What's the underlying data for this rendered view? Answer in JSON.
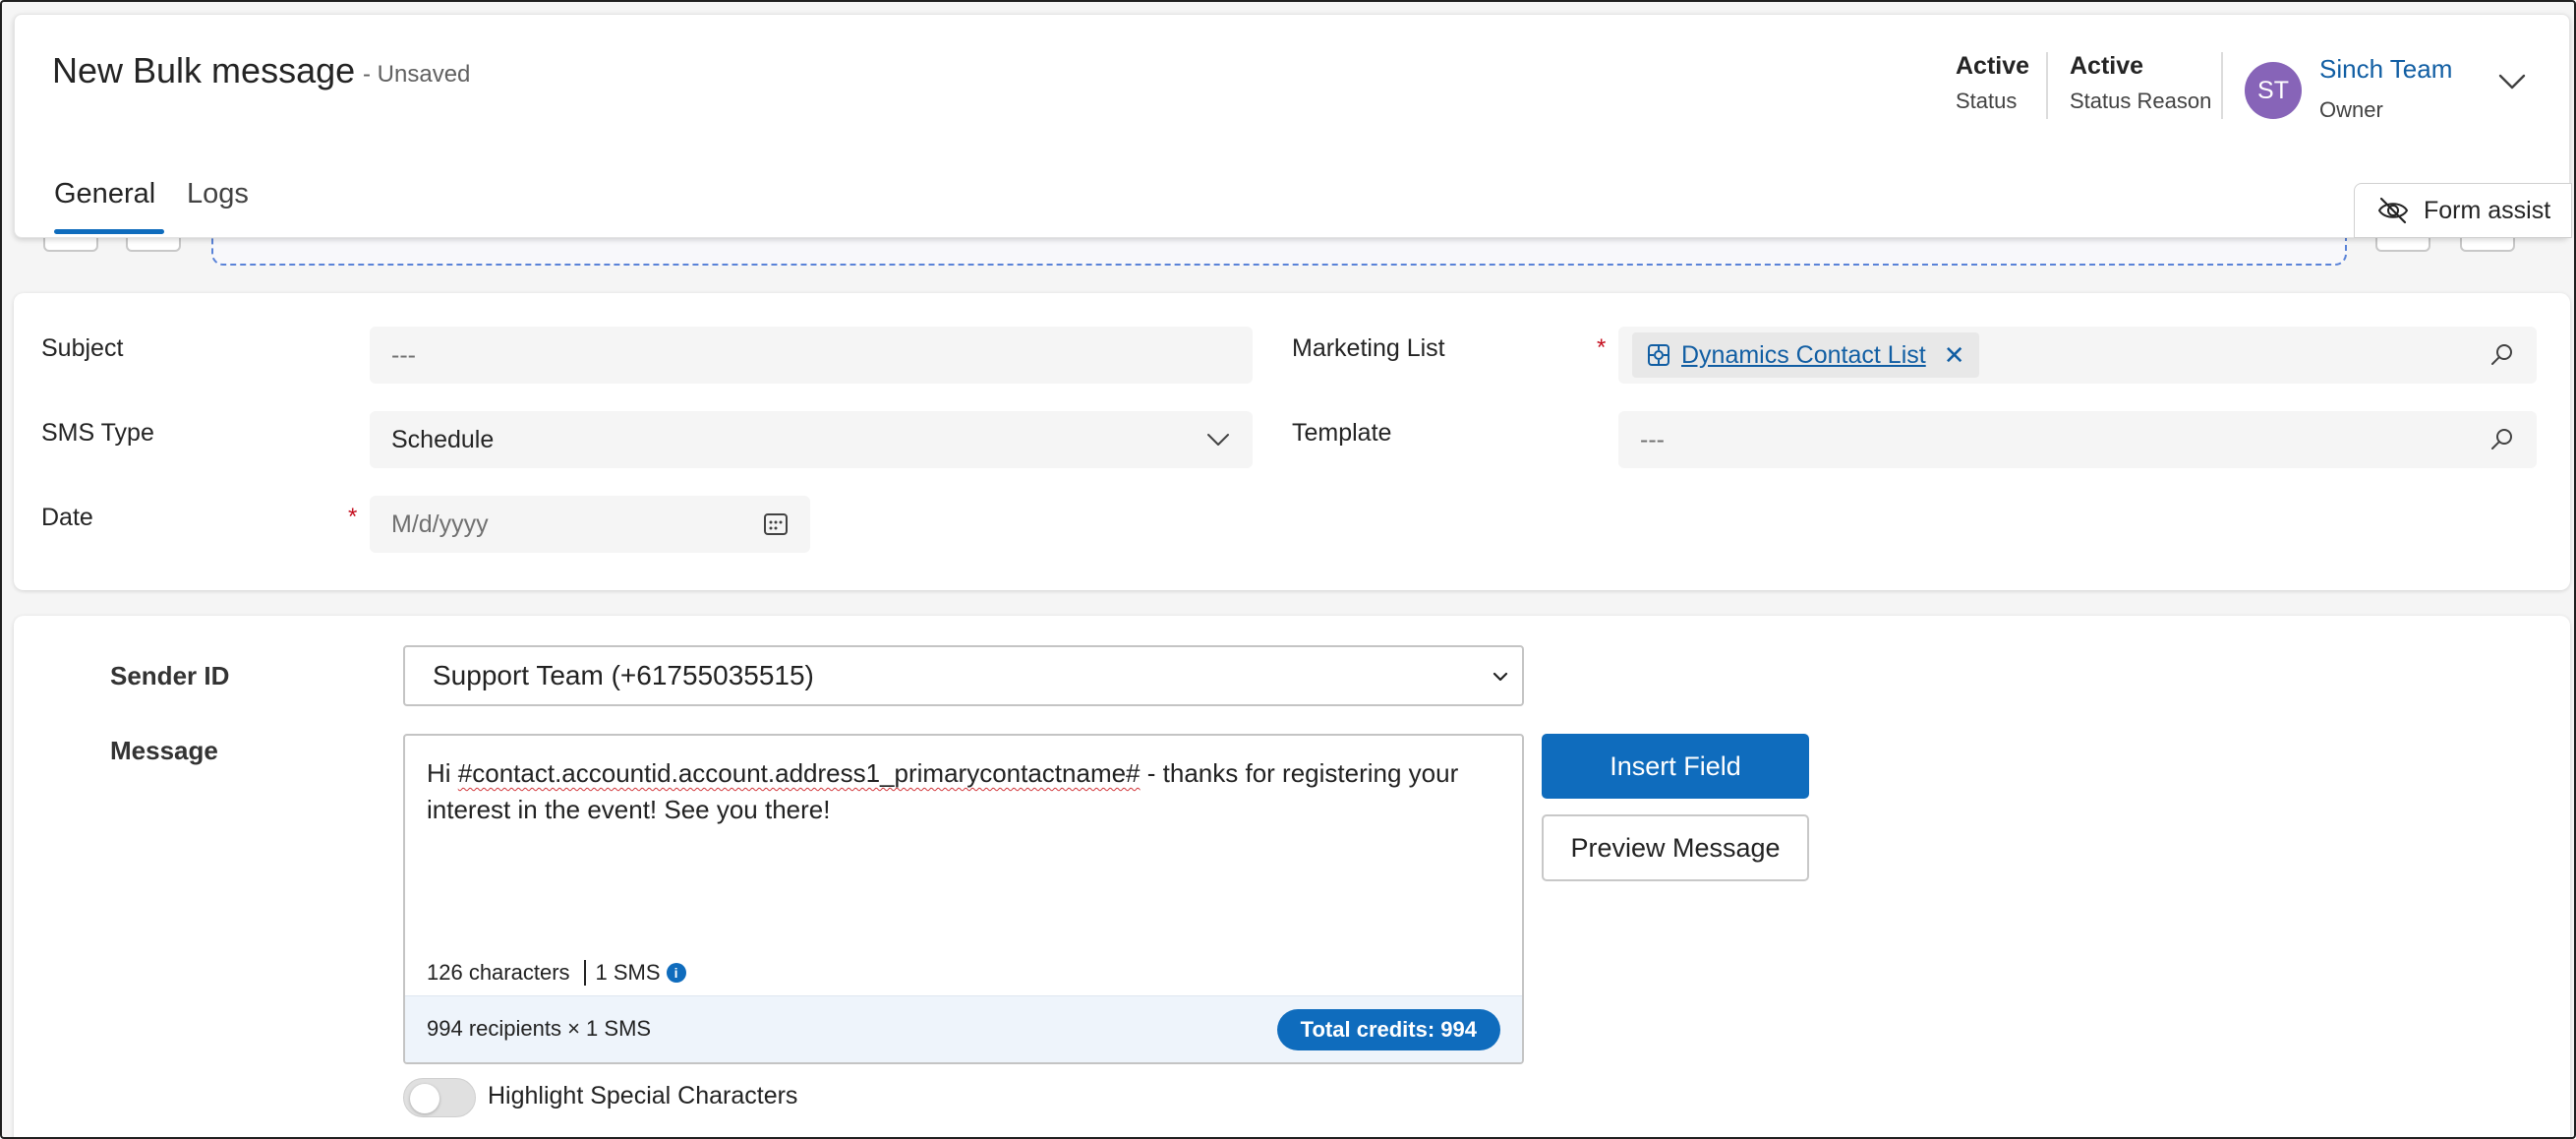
{
  "header": {
    "title": "New Bulk message",
    "save_state": "- Unsaved",
    "status": {
      "value": "Active",
      "label": "Status"
    },
    "status_reason": {
      "value": "Active",
      "label": "Status Reason"
    },
    "owner": {
      "initials": "ST",
      "name": "Sinch Team",
      "label": "Owner",
      "avatar_color": "#8764b8"
    },
    "tabs": [
      {
        "label": "General",
        "active": true
      },
      {
        "label": "Logs",
        "active": false
      }
    ],
    "form_assist_label": "Form assist"
  },
  "fields": {
    "subject": {
      "label": "Subject",
      "value": "---"
    },
    "sms_type": {
      "label": "SMS Type",
      "value": "Schedule"
    },
    "date": {
      "label": "Date",
      "required": "*",
      "placeholder": "M/d/yyyy"
    },
    "marketing_list": {
      "label": "Marketing List",
      "required": "*",
      "value": "Dynamics Contact List"
    },
    "template": {
      "label": "Template",
      "value": "---"
    }
  },
  "sms": {
    "sender_label": "Sender ID",
    "sender_value": "Support Team (+61755035515)",
    "message_label": "Message",
    "message_prefix": "Hi ",
    "message_token": "#contact.accountid.account.address1_primarycontactname#",
    "message_suffix": " - thanks for registering your interest in the event! See you there!",
    "char_count": "126 characters",
    "sms_count": "1 SMS",
    "recipients": "994 recipients × 1 SMS",
    "total_credits": "Total credits: 994",
    "insert_field_label": "Insert Field",
    "preview_label": "Preview Message",
    "highlight_label": "Highlight Special Characters",
    "highlight_on": false
  },
  "colors": {
    "accent": "#0f6cbd",
    "link": "#115ea3",
    "required": "#c50f1f"
  }
}
